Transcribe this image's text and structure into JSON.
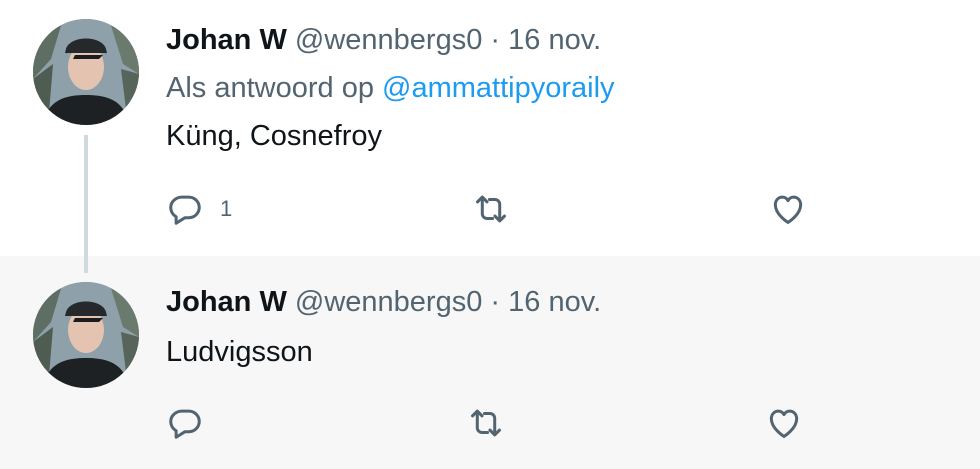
{
  "tweets": [
    {
      "name": "Johan W",
      "handle": "@wennbergs0",
      "separator": "·",
      "date": "16 nov.",
      "reply_prefix": "Als antwoord op",
      "reply_mention": "@ammattipyoraily",
      "text": "Küng, Cosnefroy",
      "reply_count": "1",
      "icons": [
        "reply-icon",
        "retweet-icon",
        "like-icon"
      ]
    },
    {
      "name": "Johan W",
      "handle": "@wennbergs0",
      "separator": "·",
      "date": "16 nov.",
      "text": "Ludvigsson",
      "icons": [
        "reply-icon",
        "retweet-icon",
        "like-icon"
      ]
    }
  ],
  "colors": {
    "text": "#0f1419",
    "secondary": "#536471",
    "link": "#1d9bf0",
    "thread_line": "#cfd9de",
    "hover_bg": "#f7f7f7"
  }
}
